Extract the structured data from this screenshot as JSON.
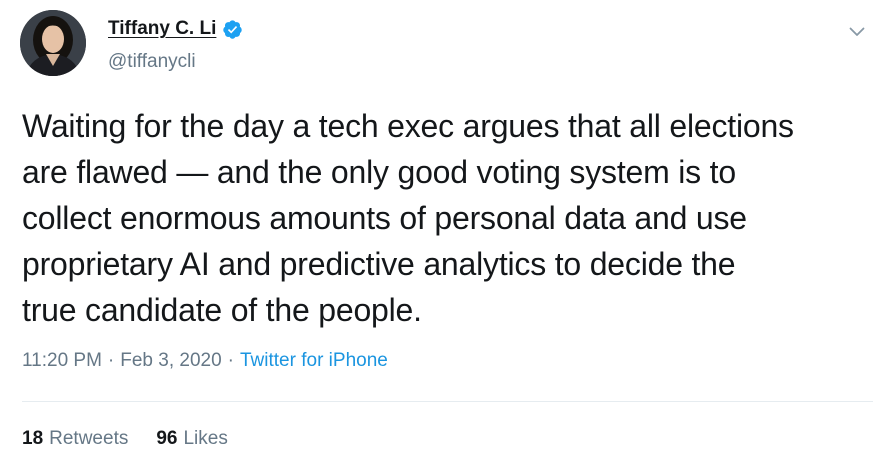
{
  "user": {
    "display_name": "Tiffany C. Li",
    "handle": "@tiffanycli",
    "verified": true
  },
  "tweet": {
    "text": "Waiting for the day a tech exec argues that all elections\nare flawed — and the only good voting system is to\ncollect enormous amounts of personal data and use\nproprietary AI and predictive analytics to decide the\ntrue candidate of the people.",
    "time": "11:20 PM",
    "separator": "·",
    "date": "Feb 3, 2020",
    "source": "Twitter for iPhone"
  },
  "stats": {
    "retweets_count": "18",
    "retweets_label": "Retweets",
    "likes_count": "96",
    "likes_label": "Likes"
  },
  "icons": {
    "verified": "verified-badge-icon",
    "caret": "chevron-down-icon"
  },
  "colors": {
    "text": "#14171a",
    "secondary": "#657786",
    "link": "#1b95e0",
    "verified": "#1da1f2",
    "divider": "#e6ecf0"
  }
}
